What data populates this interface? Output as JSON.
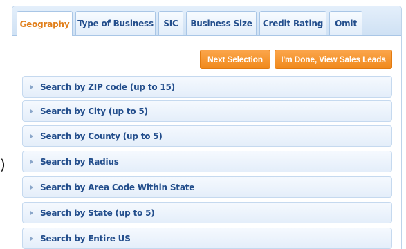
{
  "stray_glyph": ")",
  "tabs": [
    {
      "label": "Geography",
      "active": true
    },
    {
      "label": "Type of Business",
      "active": false
    },
    {
      "label": "SIC",
      "active": false
    },
    {
      "label": "Business Size",
      "active": false
    },
    {
      "label": "Credit Rating",
      "active": false
    },
    {
      "label": "Omit",
      "active": false
    }
  ],
  "actions": {
    "next_label": "Next Selection",
    "done_label": "I'm Done, View Sales Leads"
  },
  "sections": [
    {
      "label": "Search by ZIP code (up to 15)",
      "icon": "expand-arrow-icon"
    },
    {
      "label": "Search by City (up to 5)",
      "icon": "expand-arrow-icon"
    },
    {
      "label": "Search by County (up to 5)",
      "icon": "expand-arrow-icon"
    },
    {
      "label": "Search by Radius",
      "icon": "expand-arrow-icon"
    },
    {
      "label": "Search by Area Code Within State",
      "icon": "expand-arrow-icon"
    },
    {
      "label": "Search by State (up to 5)",
      "icon": "expand-arrow-icon"
    },
    {
      "label": "Search by Entire US",
      "icon": "expand-arrow-icon"
    }
  ],
  "colors": {
    "accent_orange": "#f0891c",
    "active_tab_text": "#e1801d",
    "link_blue": "#234e8c",
    "row_border": "#c5d9ef"
  }
}
